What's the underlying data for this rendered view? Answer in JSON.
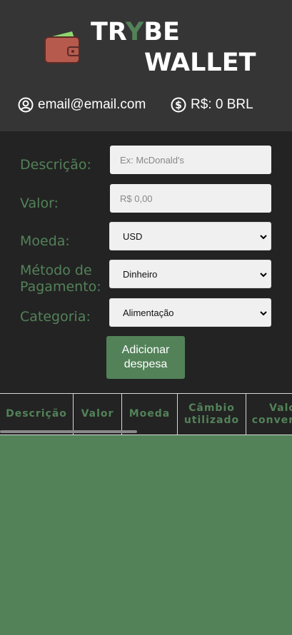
{
  "header": {
    "logo_part1": "TR",
    "logo_y": "Y",
    "logo_part2": "BE",
    "logo_line2": "WALLET",
    "email": "email@email.com",
    "total": "R$: 0 BRL",
    "icons": [
      "wallet-icon",
      "user-circle-icon",
      "dollar-circle-icon"
    ]
  },
  "form": {
    "description_label": "Descrição:",
    "description_placeholder": "Ex: McDonald's",
    "value_label": "Valor:",
    "value_placeholder": "R$ 0,00",
    "currency_label": "Moeda:",
    "currency_selected": "USD",
    "method_label": "Método de Pagamento:",
    "method_selected": "Dinheiro",
    "category_label": "Categoria:",
    "category_selected": "Alimentação",
    "add_button": "Adicionar despesa"
  },
  "table": {
    "headers": [
      "Descrição",
      "Valor",
      "Moeda",
      "Câmbio utilizado",
      "Valor convertido"
    ]
  },
  "colors": {
    "accent": "#538259",
    "header_bg": "#353535",
    "form_bg": "#232323",
    "input_bg": "#f0f0f0"
  }
}
